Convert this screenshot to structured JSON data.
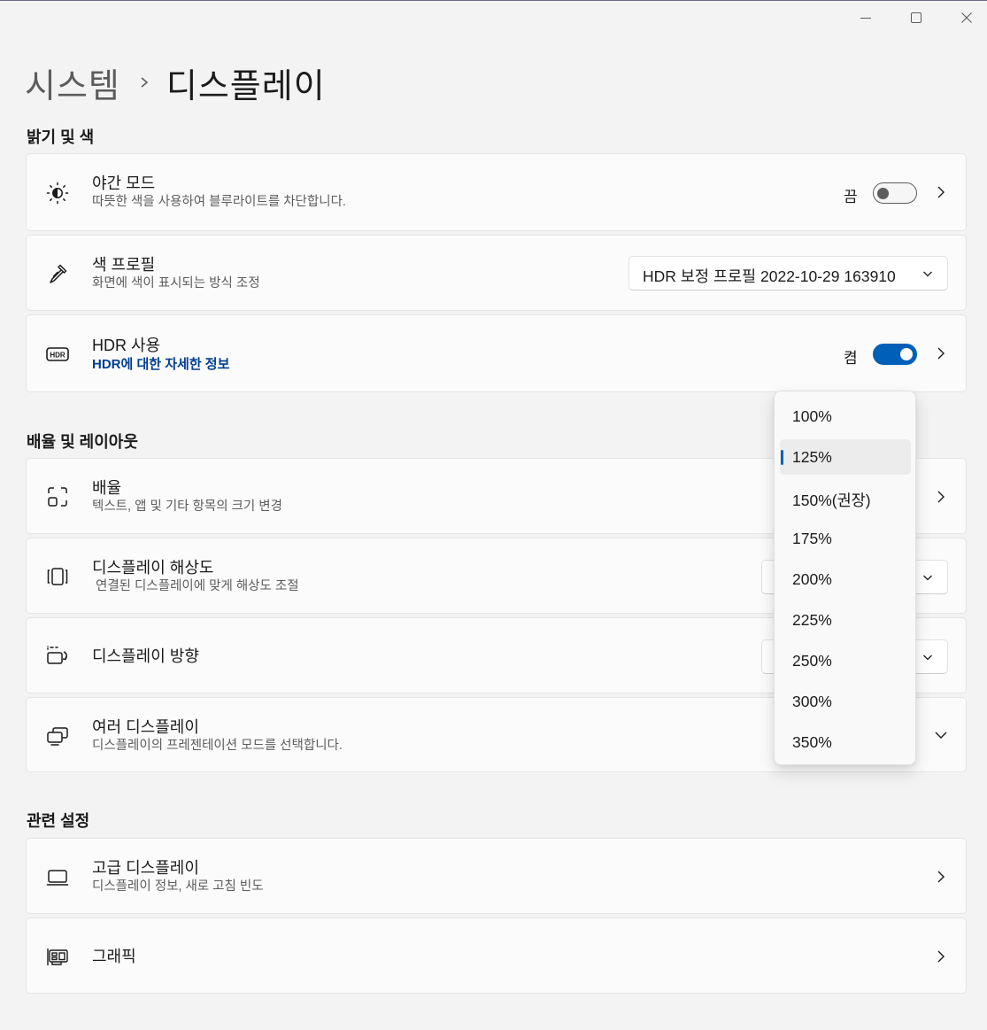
{
  "window": {
    "minimize_icon": "minimize-icon",
    "maximize_icon": "maximize-icon",
    "close_icon": "close-icon"
  },
  "breadcrumb": {
    "parent": "시스템",
    "current": "디스플레이"
  },
  "sections": {
    "brightness_color": "밝기 및 색",
    "scale_layout": "배율 및 레이아웃",
    "related": "관련 설정"
  },
  "night_mode": {
    "icon": "brightness-icon",
    "title": "야간 모드",
    "subtitle": "따뜻한 색을 사용하여 블루라이트를 차단합니다.",
    "state": "끔",
    "enabled": false
  },
  "color_profile": {
    "icon": "eyedropper-icon",
    "title": "색 프로필",
    "subtitle": "화면에 색이 표시되는 방식 조정",
    "value": "HDR 보정 프로필 2022-10-29 163910"
  },
  "hdr": {
    "icon": "hdr-icon",
    "title": "HDR 사용",
    "link": "HDR에 대한 자세한 정보",
    "state": "켬",
    "enabled": true
  },
  "scale": {
    "icon": "scale-icon",
    "title": "배율",
    "subtitle": "텍스트, 앱 및 기타 항목의 크기 변경"
  },
  "resolution": {
    "icon": "resolution-icon",
    "title": "디스플레이 해상도",
    "subtitle": "연결된 디스플레이에 맞게 해상도 조절"
  },
  "orientation": {
    "icon": "orientation-icon",
    "title": "디스플레이 방향"
  },
  "multiple_displays": {
    "icon": "multiple-displays-icon",
    "title": "여러 디스플레이",
    "subtitle": "디스플레이의 프레젠테이션 모드를 선택합니다."
  },
  "advanced_display": {
    "icon": "laptop-icon",
    "title": "고급 디스플레이",
    "subtitle": "디스플레이 정보, 새로 고침 빈도"
  },
  "graphics": {
    "icon": "graphics-card-icon",
    "title": "그래픽"
  },
  "scale_dropdown": {
    "options": [
      "100%",
      "125%",
      "150%(권장)",
      "175%",
      "200%",
      "225%",
      "250%",
      "300%",
      "350%"
    ],
    "selected": "125%"
  }
}
